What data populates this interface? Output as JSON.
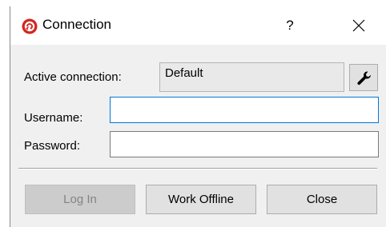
{
  "window": {
    "title": "Connection",
    "help_label": "?",
    "app_icon": "red-circle-logo-icon",
    "close_icon": "close-icon"
  },
  "form": {
    "active_connection_label": "Active connection:",
    "active_connection_value": "Default",
    "settings_icon": "wrench-icon",
    "username_label": "Username:",
    "username_value": "",
    "password_label": "Password:",
    "password_value": ""
  },
  "buttons": {
    "login_label": "Log In",
    "login_enabled": false,
    "work_offline_label": "Work Offline",
    "close_label": "Close"
  },
  "colors": {
    "logo_red": "#d4261f",
    "focus_border": "#0078d7",
    "dialog_bg": "#f0f0f0"
  }
}
